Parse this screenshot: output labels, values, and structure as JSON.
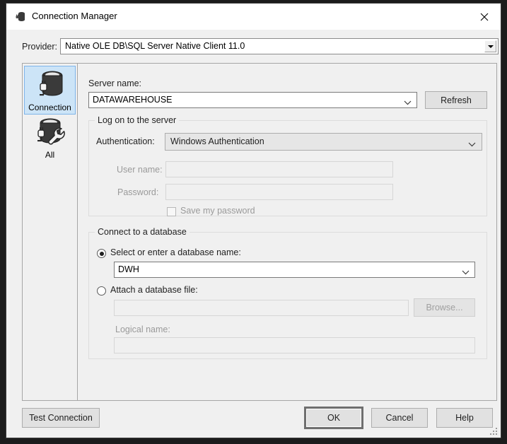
{
  "window": {
    "title": "Connection Manager",
    "title_icon": "database-plug-icon",
    "close_icon": "close-icon"
  },
  "provider": {
    "label": "Provider:",
    "value": "Native OLE DB\\SQL Server Native Client 11.0",
    "dropdown_icon": "triangle-down-icon"
  },
  "sidebar": {
    "items": [
      {
        "label": "Connection",
        "icon": "database-plug-icon",
        "selected": true
      },
      {
        "label": "All",
        "icon": "database-plug-wrench-icon",
        "selected": false
      }
    ]
  },
  "main": {
    "server_name": {
      "label": "Server name:",
      "value": "DATAWAREHOUSE",
      "chevron_icon": "chevron-down-icon"
    },
    "refresh_button": "Refresh",
    "logon_group": {
      "caption": "Log on to the server",
      "authentication": {
        "label": "Authentication:",
        "value": "Windows Authentication",
        "chevron_icon": "chevron-down-icon"
      },
      "user_name": {
        "label": "User name:",
        "value": "",
        "disabled": true
      },
      "password": {
        "label": "Password:",
        "value": "",
        "disabled": true
      },
      "save_password": {
        "label": "Save my password",
        "checked": false,
        "disabled": true
      }
    },
    "database_group": {
      "caption": "Connect to a database",
      "select_option": {
        "label": "Select or enter a database name:",
        "selected": true,
        "value": "DWH",
        "chevron_icon": "chevron-down-icon"
      },
      "attach_option": {
        "label": "Attach a database file:",
        "selected": false,
        "value": "",
        "browse_button": "Browse...",
        "logical_name": {
          "label": "Logical name:",
          "value": ""
        }
      }
    }
  },
  "footer": {
    "test_connection": "Test Connection",
    "ok": "OK",
    "cancel": "Cancel",
    "help": "Help"
  },
  "colors": {
    "dialog_bg": "#f0f0f0",
    "titlebar_bg": "#ffffff",
    "selection_bg": "#cce4f7",
    "selection_border": "#7eb4ea",
    "button_bg": "#e1e1e1",
    "disabled_text": "#9a9a9a"
  }
}
